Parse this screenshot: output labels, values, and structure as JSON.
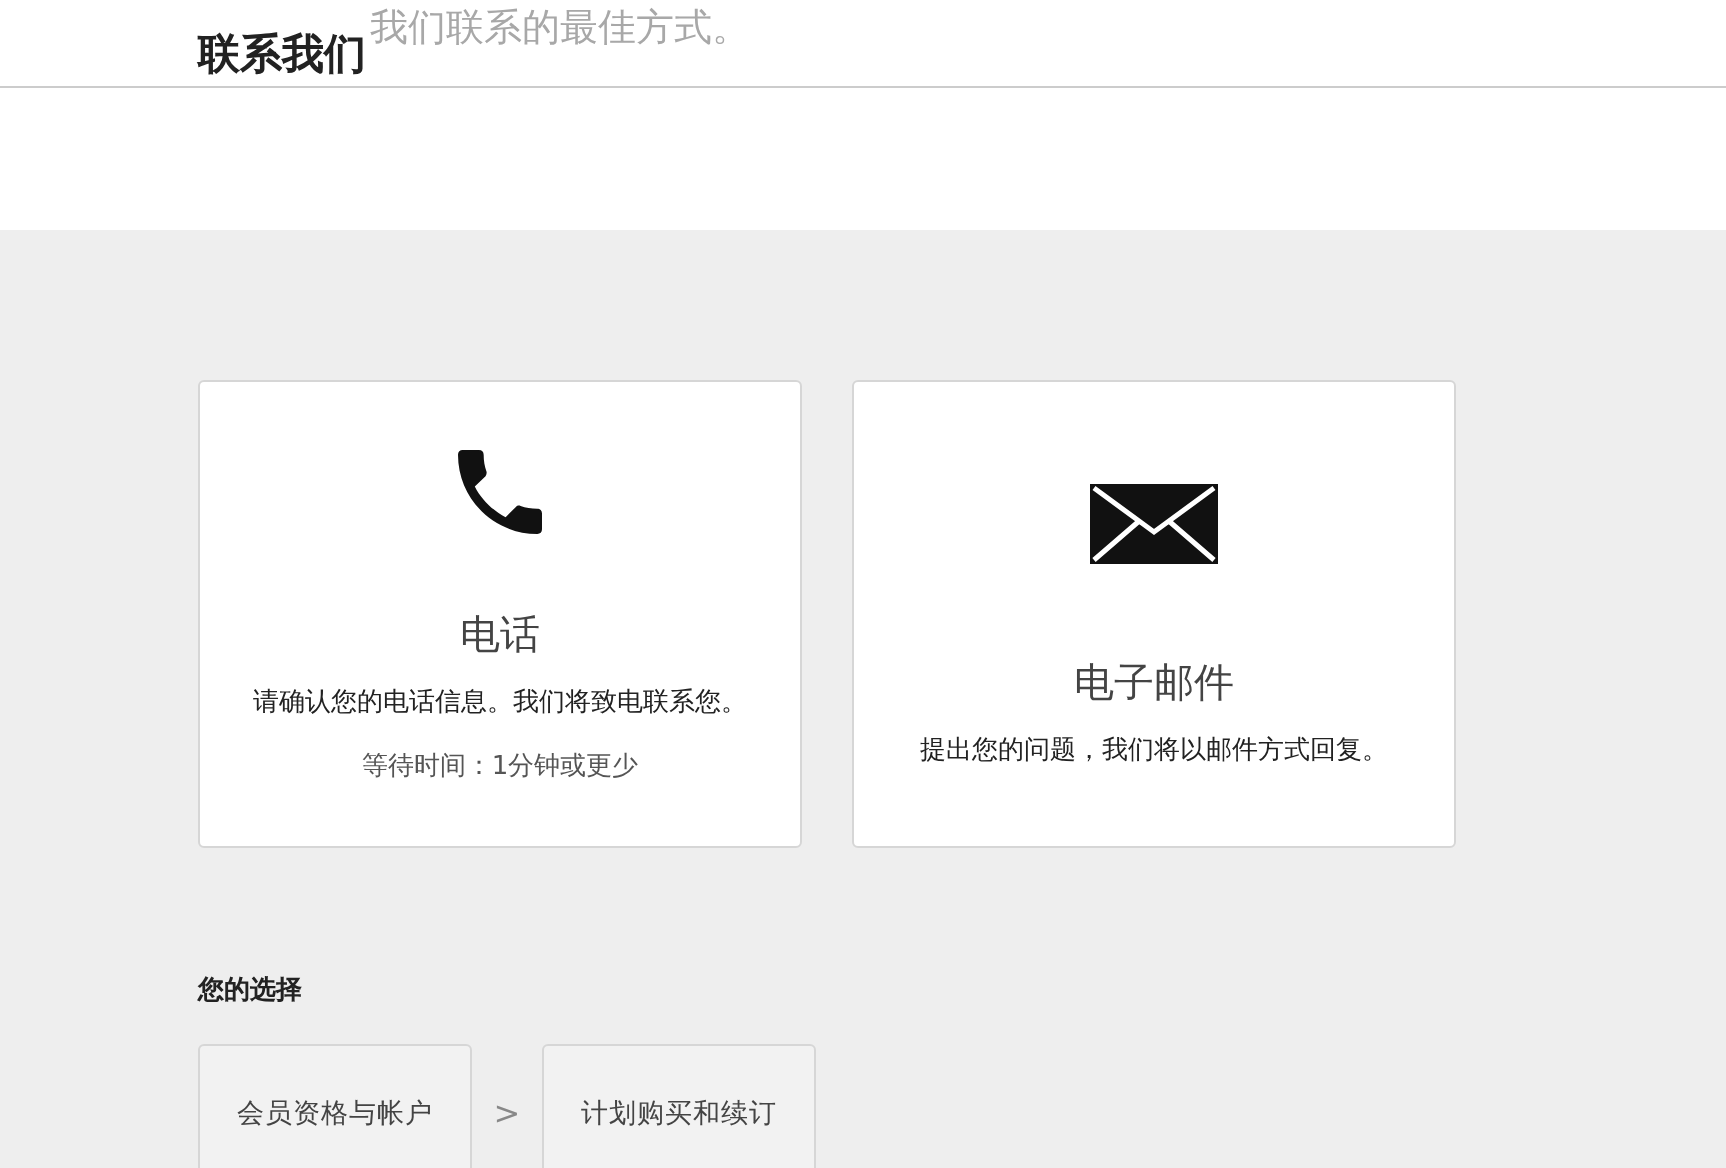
{
  "header": {
    "title": "联系我们",
    "subtitle": "我们联系的最佳方式。"
  },
  "options": [
    {
      "kind": "phone",
      "title": "电话",
      "description": "请确认您的电话信息。我们将致电联系您。",
      "wait": "等待时间：1分钟或更少"
    },
    {
      "kind": "email",
      "title": "电子邮件",
      "description": "提出您的问题，我们将以邮件方式回复。"
    }
  ],
  "choices": {
    "heading": "您的选择",
    "steps": [
      "会员资格与帐户",
      "计划购买和续订"
    ],
    "separator": ">"
  }
}
